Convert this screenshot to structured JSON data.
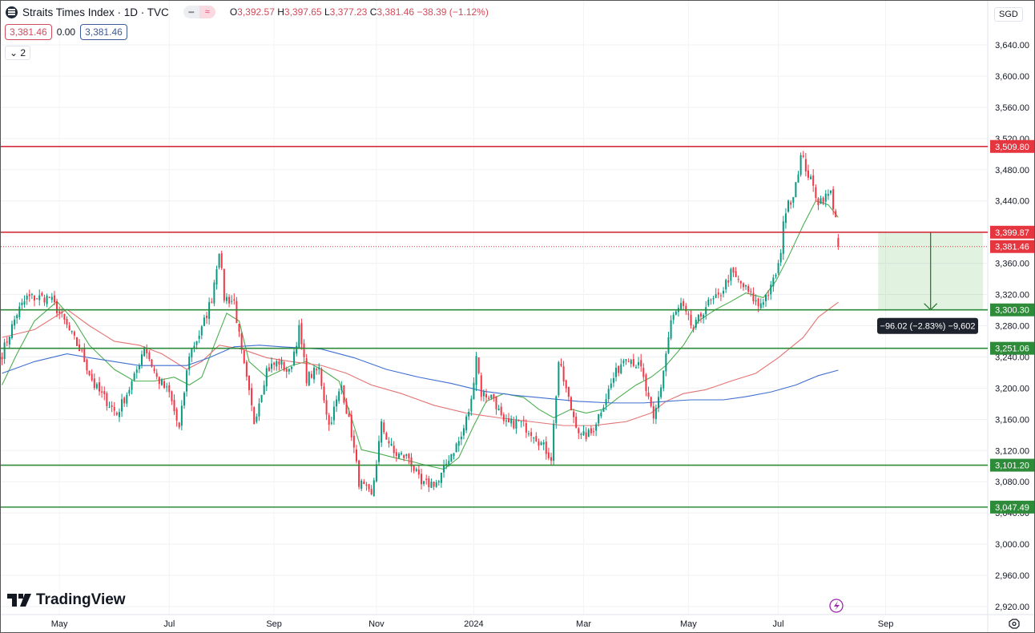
{
  "header": {
    "title": "Straits Times Index · 1D · TVC",
    "open_label": "O",
    "open": "3,392.57",
    "high_label": "H",
    "high": "3,397.65",
    "low_label": "L",
    "low": "3,377.23",
    "close_label": "C",
    "close": "3,381.46",
    "change": "−38.39 (−1.12%)",
    "bid": "3,381.46",
    "spread": "0.00",
    "ask": "3,381.46",
    "indicators_toggle": "2",
    "currency": "SGD"
  },
  "branding": {
    "logo_text": "TradingView"
  },
  "colors": {
    "up": "#089981",
    "down": "#f23645",
    "ma_fast": "#4caf50",
    "ma_mid": "#e57373",
    "ma_slow": "#3f6fd1",
    "resistance": "#d32f3c",
    "support": "#2e8b3a"
  },
  "chart_data": {
    "type": "candlestick",
    "title": "Straits Times Index · 1D · TVC",
    "ylim": [
      2900,
      3660
    ],
    "y_ticks": [
      "3,640.00",
      "3,600.00",
      "3,560.00",
      "3,520.00",
      "3,480.00",
      "3,440.00",
      "3,400.00",
      "3,360.00",
      "3,320.00",
      "3,280.00",
      "3,240.00",
      "3,200.00",
      "3,160.00",
      "3,120.00",
      "3,080.00",
      "3,040.00",
      "3,000.00",
      "2,960.00",
      "2,920.00"
    ],
    "y_tick_values": [
      3640,
      3600,
      3560,
      3520,
      3480,
      3440,
      3400,
      3360,
      3320,
      3280,
      3240,
      3200,
      3160,
      3120,
      3080,
      3040,
      3000,
      2960,
      2920
    ],
    "x_ticks": [
      {
        "label": "May",
        "bar": 23
      },
      {
        "label": "Jul",
        "bar": 67
      },
      {
        "label": "Sep",
        "bar": 109
      },
      {
        "label": "Nov",
        "bar": 150
      },
      {
        "label": "2024",
        "bar": 189
      },
      {
        "label": "Mar",
        "bar": 233
      },
      {
        "label": "May",
        "bar": 275
      },
      {
        "label": "Jul",
        "bar": 311
      },
      {
        "label": "Sep",
        "bar": 354
      }
    ],
    "bars_visible": 396,
    "close_path": [
      [
        0,
        3244
      ],
      [
        6,
        3296
      ],
      [
        10,
        3316
      ],
      [
        19,
        3316
      ],
      [
        24,
        3291
      ],
      [
        32,
        3244
      ],
      [
        37,
        3203
      ],
      [
        46,
        3167
      ],
      [
        53,
        3213
      ],
      [
        57,
        3255
      ],
      [
        62,
        3213
      ],
      [
        67,
        3193
      ],
      [
        71,
        3147
      ],
      [
        75,
        3244
      ],
      [
        80,
        3275
      ],
      [
        84,
        3316
      ],
      [
        87,
        3378
      ],
      [
        89,
        3316
      ],
      [
        93,
        3311
      ],
      [
        96,
        3244
      ],
      [
        101,
        3157
      ],
      [
        106,
        3224
      ],
      [
        111,
        3234
      ],
      [
        115,
        3219
      ],
      [
        119,
        3275
      ],
      [
        122,
        3213
      ],
      [
        127,
        3224
      ],
      [
        131,
        3152
      ],
      [
        136,
        3203
      ],
      [
        140,
        3142
      ],
      [
        143,
        3080
      ],
      [
        148,
        3060
      ],
      [
        152,
        3152
      ],
      [
        157,
        3116
      ],
      [
        163,
        3111
      ],
      [
        168,
        3075
      ],
      [
        175,
        3080
      ],
      [
        179,
        3111
      ],
      [
        184,
        3137
      ],
      [
        188,
        3183
      ],
      [
        190,
        3244
      ],
      [
        192,
        3193
      ],
      [
        197,
        3188
      ],
      [
        201,
        3152
      ],
      [
        207,
        3157
      ],
      [
        213,
        3142
      ],
      [
        220,
        3111
      ],
      [
        223,
        3234
      ],
      [
        228,
        3173
      ],
      [
        232,
        3137
      ],
      [
        236,
        3142
      ],
      [
        240,
        3173
      ],
      [
        245,
        3213
      ],
      [
        250,
        3244
      ],
      [
        256,
        3224
      ],
      [
        261,
        3157
      ],
      [
        264,
        3203
      ],
      [
        268,
        3286
      ],
      [
        272,
        3306
      ],
      [
        277,
        3275
      ],
      [
        282,
        3306
      ],
      [
        287,
        3316
      ],
      [
        292,
        3347
      ],
      [
        298,
        3327
      ],
      [
        303,
        3306
      ],
      [
        308,
        3327
      ],
      [
        312,
        3368
      ],
      [
        313,
        3419
      ],
      [
        317,
        3450
      ],
      [
        320,
        3496
      ],
      [
        321,
        3491
      ],
      [
        324,
        3465
      ],
      [
        327,
        3440
      ],
      [
        330,
        3445
      ],
      [
        332,
        3450
      ],
      [
        334,
        3419
      ]
    ],
    "last_candle": {
      "bar": 335,
      "open": 3392.57,
      "high": 3397.65,
      "low": 3377.23,
      "close": 3381.46
    },
    "series": [
      {
        "name": "MA fast",
        "color": "#4caf50",
        "points": [
          [
            0,
            3204
          ],
          [
            6,
            3244
          ],
          [
            13,
            3286
          ],
          [
            22,
            3311
          ],
          [
            29,
            3286
          ],
          [
            35,
            3255
          ],
          [
            45,
            3224
          ],
          [
            53,
            3209
          ],
          [
            61,
            3209
          ],
          [
            69,
            3214
          ],
          [
            75,
            3204
          ],
          [
            80,
            3214
          ],
          [
            85,
            3255
          ],
          [
            90,
            3296
          ],
          [
            95,
            3286
          ],
          [
            99,
            3234
          ],
          [
            106,
            3214
          ],
          [
            116,
            3229
          ],
          [
            122,
            3234
          ],
          [
            128,
            3224
          ],
          [
            135,
            3209
          ],
          [
            140,
            3162
          ],
          [
            144,
            3121
          ],
          [
            151,
            3116
          ],
          [
            157,
            3111
          ],
          [
            164,
            3106
          ],
          [
            170,
            3101
          ],
          [
            177,
            3096
          ],
          [
            183,
            3111
          ],
          [
            189,
            3152
          ],
          [
            194,
            3183
          ],
          [
            201,
            3193
          ],
          [
            209,
            3188
          ],
          [
            215,
            3173
          ],
          [
            221,
            3162
          ],
          [
            228,
            3173
          ],
          [
            234,
            3168
          ],
          [
            241,
            3173
          ],
          [
            247,
            3188
          ],
          [
            254,
            3204
          ],
          [
            260,
            3214
          ],
          [
            266,
            3229
          ],
          [
            273,
            3255
          ],
          [
            279,
            3286
          ],
          [
            286,
            3301
          ],
          [
            292,
            3311
          ],
          [
            298,
            3322
          ],
          [
            305,
            3316
          ],
          [
            310,
            3337
          ],
          [
            315,
            3368
          ],
          [
            321,
            3409
          ],
          [
            326,
            3440
          ],
          [
            331,
            3435
          ],
          [
            335,
            3419
          ]
        ]
      },
      {
        "name": "MA mid",
        "color": "#e57373",
        "points": [
          [
            0,
            3265
          ],
          [
            13,
            3275
          ],
          [
            26,
            3301
          ],
          [
            35,
            3280
          ],
          [
            45,
            3260
          ],
          [
            55,
            3255
          ],
          [
            64,
            3244
          ],
          [
            74,
            3224
          ],
          [
            80,
            3234
          ],
          [
            87,
            3255
          ],
          [
            96,
            3250
          ],
          [
            106,
            3239
          ],
          [
            116,
            3234
          ],
          [
            128,
            3229
          ],
          [
            138,
            3219
          ],
          [
            148,
            3204
          ],
          [
            160,
            3193
          ],
          [
            173,
            3178
          ],
          [
            186,
            3168
          ],
          [
            199,
            3162
          ],
          [
            212,
            3157
          ],
          [
            225,
            3152
          ],
          [
            237,
            3152
          ],
          [
            250,
            3157
          ],
          [
            260,
            3168
          ],
          [
            266,
            3183
          ],
          [
            273,
            3193
          ],
          [
            282,
            3198
          ],
          [
            292,
            3209
          ],
          [
            302,
            3219
          ],
          [
            311,
            3239
          ],
          [
            321,
            3265
          ],
          [
            327,
            3291
          ],
          [
            335,
            3310
          ]
        ]
      },
      {
        "name": "MA slow",
        "color": "#3f6fd1",
        "points": [
          [
            0,
            3219
          ],
          [
            13,
            3234
          ],
          [
            26,
            3244
          ],
          [
            35,
            3239
          ],
          [
            45,
            3234
          ],
          [
            55,
            3229
          ],
          [
            64,
            3229
          ],
          [
            74,
            3229
          ],
          [
            83,
            3239
          ],
          [
            93,
            3253
          ],
          [
            103,
            3255
          ],
          [
            112,
            3253
          ],
          [
            128,
            3250
          ],
          [
            141,
            3239
          ],
          [
            154,
            3224
          ],
          [
            167,
            3214
          ],
          [
            180,
            3206
          ],
          [
            193,
            3196
          ],
          [
            205,
            3191
          ],
          [
            218,
            3187
          ],
          [
            231,
            3183
          ],
          [
            244,
            3181
          ],
          [
            257,
            3181
          ],
          [
            266,
            3183
          ],
          [
            276,
            3185
          ],
          [
            289,
            3185
          ],
          [
            298,
            3189
          ],
          [
            308,
            3195
          ],
          [
            318,
            3204
          ],
          [
            327,
            3216
          ],
          [
            335,
            3223
          ]
        ]
      }
    ],
    "horizontal_lines": [
      {
        "price": 3509.8,
        "label": "3,509.80",
        "kind": "resistance"
      },
      {
        "price": 3399.87,
        "label": "3,399.87",
        "kind": "resistance"
      },
      {
        "price": 3300.3,
        "label": "3,300.30",
        "kind": "support"
      },
      {
        "price": 3251.06,
        "label": "3,251.06",
        "kind": "support"
      },
      {
        "price": 3101.2,
        "label": "3,101.20",
        "kind": "support"
      },
      {
        "price": 3047.49,
        "label": "3,047.49",
        "kind": "support"
      }
    ],
    "last_price": {
      "price": 3381.46,
      "label": "3,381.46"
    },
    "measure": {
      "from": 3399.87,
      "to": 3300.3,
      "start_bar": 351,
      "end_bar": 393,
      "label": "−96.02 (−2.83%) −9,602"
    }
  }
}
